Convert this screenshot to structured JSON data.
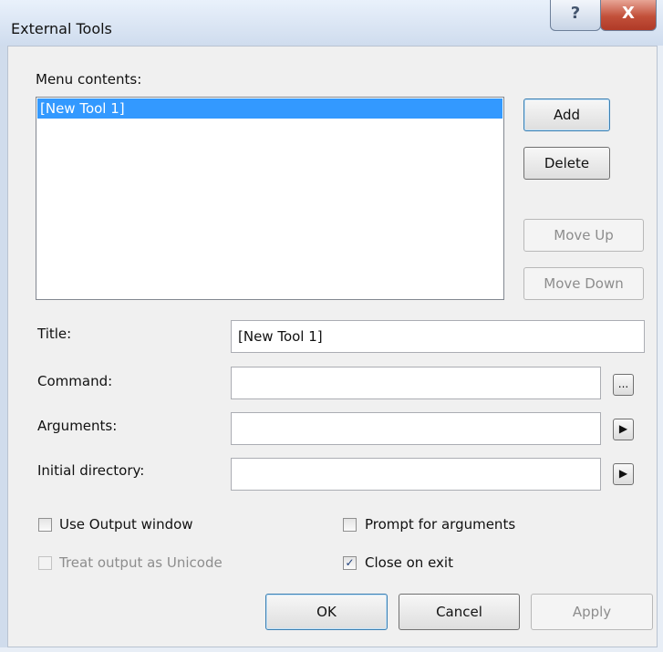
{
  "window": {
    "title": "External Tools",
    "help_glyph": "?",
    "close_glyph": "X"
  },
  "menu": {
    "label": "Menu contents:",
    "items": [
      "[New Tool 1]"
    ]
  },
  "buttons": {
    "add": "Add",
    "delete": "Delete",
    "move_up": "Move Up",
    "move_down": "Move Down",
    "ok": "OK",
    "cancel": "Cancel",
    "apply": "Apply"
  },
  "fields": {
    "title_label": "Title:",
    "title_value": "[New Tool 1]",
    "command_label": "Command:",
    "command_value": "",
    "browse_glyph": "...",
    "arguments_label": "Arguments:",
    "arguments_value": "",
    "initial_dir_label": "Initial directory:",
    "initial_dir_value": "",
    "arrow_glyph": "▶"
  },
  "options": {
    "use_output": {
      "label": "Use Output window",
      "checked": false,
      "enabled": true
    },
    "prompt_args": {
      "label": "Prompt for arguments",
      "checked": false,
      "enabled": true
    },
    "unicode": {
      "label": "Treat output as Unicode",
      "checked": false,
      "enabled": false
    },
    "close_exit": {
      "label": "Close on exit",
      "checked": true,
      "enabled": true
    }
  },
  "colors": {
    "selection": "#3399ff",
    "dialog_bg": "#f0f0f0",
    "close_red": "#c2503a"
  }
}
